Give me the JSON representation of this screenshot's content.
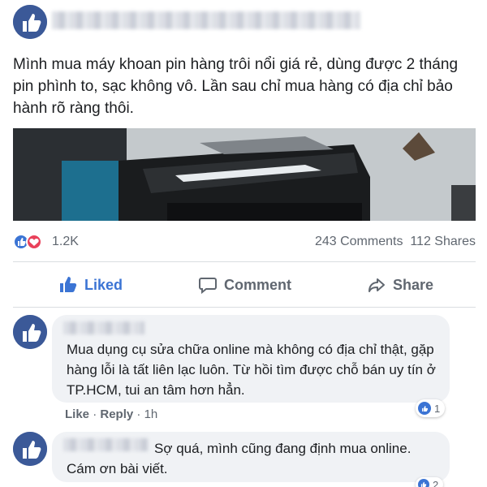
{
  "post": {
    "text": "Mình mua máy khoan pin hàng trôi nổi giá rẻ, dùng được 2 tháng pin phình to, sạc không vô.  Lần sau chỉ mua hàng có địa chỉ bảo hành rõ ràng thôi.",
    "author_avatar": "thumbs-up-avatar"
  },
  "reactions": {
    "count": "1.2K",
    "comments": "243 Comments",
    "shares": "112 Shares",
    "icons": [
      "like-icon",
      "love-icon"
    ]
  },
  "actions": {
    "like_label": "Liked",
    "comment_label": "Comment",
    "share_label": "Share"
  },
  "comments": [
    {
      "text": "Mua dụng cụ sửa chữa online mà không có địa chỉ thật, gặp hàng lỗi là tất liên lạc luôn. Từ hồi tìm được chỗ bán uy tín ở TP.HCM, tui an tâm hơn hẳn.",
      "like": "Like",
      "reply": "Reply",
      "time": "1h",
      "reactions": "1"
    },
    {
      "text": "Sợ quá, mình cũng đang định mua online. Cám ơn bài viết.",
      "reactions": "2"
    }
  ],
  "colors": {
    "accent": "#3b74d4",
    "muted": "#606770",
    "bubble": "#f0f2f5"
  }
}
